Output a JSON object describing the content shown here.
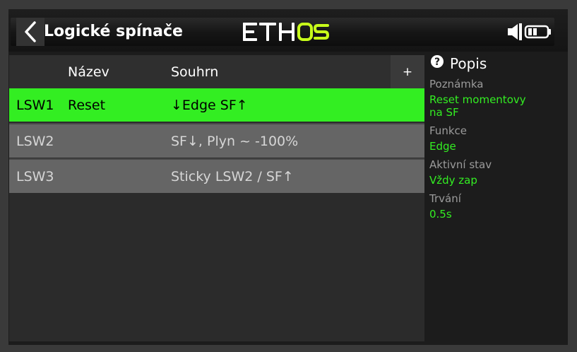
{
  "header": {
    "title": "Logické spínače",
    "logo_text": "ETHOS",
    "icons": [
      "back-chevron-icon",
      "speaker-icon",
      "battery-icon"
    ]
  },
  "table": {
    "columns": [
      "Název",
      "Souhrn"
    ],
    "add_label": "+",
    "rows": [
      {
        "id": "LSW1",
        "name": "Reset",
        "summary": "↓Edge SF↑",
        "selected": true
      },
      {
        "id": "LSW2",
        "name": "",
        "summary": "SF↓, Plyn ~ -100%",
        "selected": false
      },
      {
        "id": "LSW3",
        "name": "",
        "summary": "Sticky LSW2 / SF↑",
        "selected": false
      }
    ]
  },
  "panel": {
    "title": "Popis",
    "note_label": "Poznámka",
    "note_value_line1": "Reset momentovy",
    "note_value_line2": "na SF",
    "function_label": "Funkce",
    "function_value": "Edge",
    "active_label": "Aktivní stav",
    "active_value": "Vždy zap",
    "duration_label": "Trvání",
    "duration_value": "0.5s"
  },
  "colors": {
    "accent_green": "#33ee22",
    "background": "#1c1c1c",
    "row_gray": "#656565"
  }
}
